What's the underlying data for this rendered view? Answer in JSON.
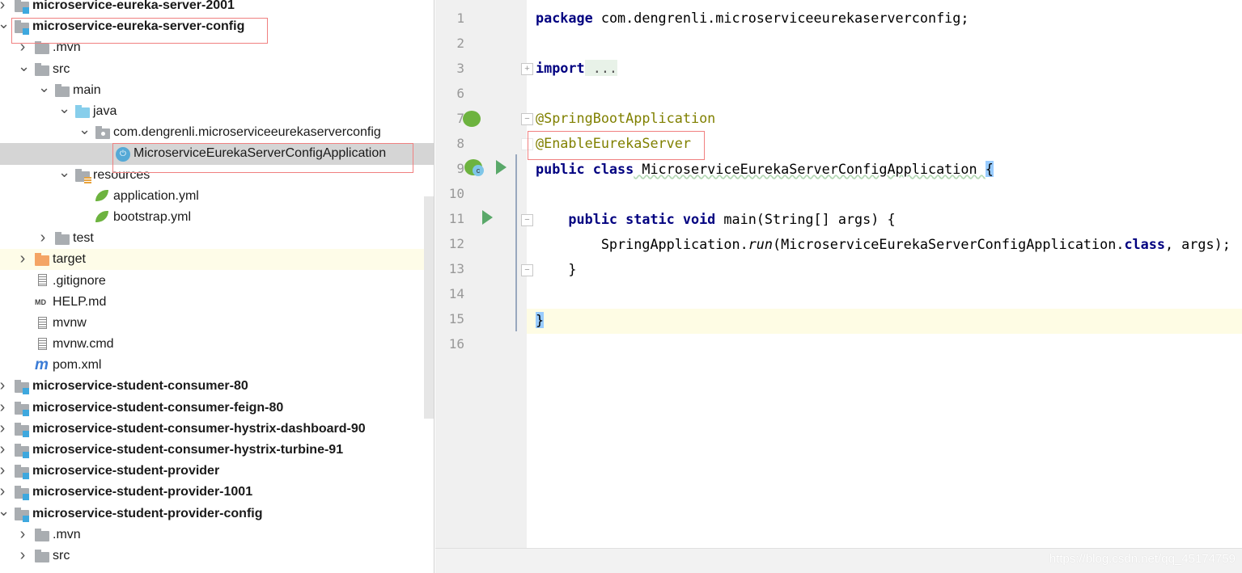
{
  "tree": {
    "rows": [
      {
        "label": "microservice-eureka-server-2001",
        "level": 0,
        "icon": "module-folder-icon",
        "arrow": "right",
        "bold": true
      },
      {
        "label": "microservice-eureka-server-config",
        "level": 0,
        "icon": "module-folder-icon",
        "arrow": "down",
        "bold": true
      },
      {
        "label": ".mvn",
        "level": 1,
        "icon": "folder-icon",
        "arrow": "right"
      },
      {
        "label": "src",
        "level": 1,
        "icon": "folder-icon",
        "arrow": "down"
      },
      {
        "label": "main",
        "level": 2,
        "icon": "folder-icon",
        "arrow": "down"
      },
      {
        "label": "java",
        "level": 3,
        "icon": "source-folder-icon",
        "arrow": "down"
      },
      {
        "label": "com.dengrenli.microserviceeurekaserverconfig",
        "level": 4,
        "icon": "package-icon",
        "arrow": "down"
      },
      {
        "label": "MicroserviceEurekaServerConfigApplication",
        "level": 5,
        "icon": "spring-boot-app-icon",
        "selected": true
      },
      {
        "label": "resources",
        "level": 3,
        "icon": "resources-folder-icon",
        "arrow": "down"
      },
      {
        "label": "application.yml",
        "level": 4,
        "icon": "spring-config-icon"
      },
      {
        "label": "bootstrap.yml",
        "level": 4,
        "icon": "spring-config-icon"
      },
      {
        "label": "test",
        "level": 2,
        "icon": "folder-icon",
        "arrow": "right"
      },
      {
        "label": "target",
        "level": 1,
        "icon": "excluded-folder-icon",
        "arrow": "right",
        "highlight": true
      },
      {
        "label": ".gitignore",
        "level": 1,
        "icon": "text-file-icon"
      },
      {
        "label": "HELP.md",
        "level": 1,
        "icon": "markdown-file-icon"
      },
      {
        "label": "mvnw",
        "level": 1,
        "icon": "text-file-icon"
      },
      {
        "label": "mvnw.cmd",
        "level": 1,
        "icon": "text-file-icon"
      },
      {
        "label": "pom.xml",
        "level": 1,
        "icon": "maven-icon"
      },
      {
        "label": "microservice-student-consumer-80",
        "level": 0,
        "icon": "module-folder-icon",
        "arrow": "right",
        "bold": true
      },
      {
        "label": "microservice-student-consumer-feign-80",
        "level": 0,
        "icon": "module-folder-icon",
        "arrow": "right",
        "bold": true
      },
      {
        "label": "microservice-student-consumer-hystrix-dashboard-90",
        "level": 0,
        "icon": "module-folder-icon",
        "arrow": "right",
        "bold": true
      },
      {
        "label": "microservice-student-consumer-hystrix-turbine-91",
        "level": 0,
        "icon": "module-folder-icon",
        "arrow": "right",
        "bold": true
      },
      {
        "label": "microservice-student-provider",
        "level": 0,
        "icon": "module-folder-icon",
        "arrow": "right",
        "bold": true
      },
      {
        "label": "microservice-student-provider-1001",
        "level": 0,
        "icon": "module-folder-icon",
        "arrow": "right",
        "bold": true
      },
      {
        "label": "microservice-student-provider-config",
        "level": 0,
        "icon": "module-folder-icon",
        "arrow": "down",
        "bold": true
      },
      {
        "label": ".mvn",
        "level": 1,
        "icon": "folder-icon",
        "arrow": "right"
      },
      {
        "label": "src",
        "level": 1,
        "icon": "folder-icon",
        "arrow": "right"
      }
    ]
  },
  "editor": {
    "line_numbers": [
      "1",
      "2",
      "3",
      "6",
      "7",
      "8",
      "9",
      "10",
      "11",
      "12",
      "13",
      "14",
      "15",
      "16"
    ],
    "code": {
      "l1_kw": "package",
      "l1_rest": " com.dengrenli.microserviceeurekaserverconfig;",
      "l3_kw": "import",
      "l3_fold": " ...",
      "l7": "@SpringBootApplication",
      "l8": "@EnableEurekaServer",
      "l9_kw": "public class",
      "l9_name": " MicroserviceEurekaServerConfigApplication ",
      "l9_brace": "{",
      "l11_kw": "    public static void",
      "l11_rest": " main(String[] args) {",
      "l12_a": "        SpringApplication.",
      "l12_run": "run",
      "l12_b": "(MicroserviceEurekaServerConfigApplication.",
      "l12_kw": "class",
      "l12_c": ", args);",
      "l13": "    }",
      "l15": "}"
    },
    "current_line": "15"
  },
  "watermark": "https://blog.csdn.net/qq_45174759"
}
